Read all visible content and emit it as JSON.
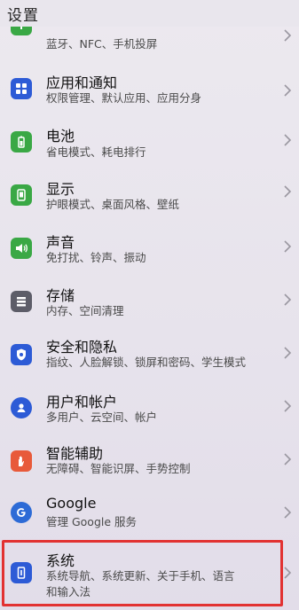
{
  "header": {
    "title": "设置"
  },
  "items": [
    {
      "label": "",
      "sub": "蓝牙、NFC、手机投屏",
      "icon": "link-icon",
      "color": "#3aa845"
    },
    {
      "label": "应用和通知",
      "sub": "权限管理、默认应用、应用分身",
      "icon": "apps-grid-icon",
      "color": "#2d5bd6"
    },
    {
      "label": "电池",
      "sub": "省电模式、耗电排行",
      "icon": "battery-icon",
      "color": "#3aa845"
    },
    {
      "label": "显示",
      "sub": "护眼模式、桌面风格、壁纸",
      "icon": "phone-display-icon",
      "color": "#3aa845"
    },
    {
      "label": "声音",
      "sub": "免打扰、铃声、振动",
      "icon": "speaker-icon",
      "color": "#3aa845"
    },
    {
      "label": "存储",
      "sub": "内存、空间清理",
      "icon": "storage-icon",
      "color": "#5d5d68"
    },
    {
      "label": "安全和隐私",
      "sub": "指纹、人脸解锁、锁屏和密码、学生模式",
      "icon": "shield-icon",
      "color": "#2d5bd6"
    },
    {
      "label": "用户和帐户",
      "sub": "多用户、云空间、帐户",
      "icon": "user-icon",
      "color": "#2d5bd6"
    },
    {
      "label": "智能辅助",
      "sub": "无障碍、智能识屏、手势控制",
      "icon": "hand-icon",
      "color": "#e85a3a"
    },
    {
      "label": "Google",
      "sub": "管理 Google 服务",
      "icon": "google-g-icon",
      "color": "#2d6bd6"
    },
    {
      "label": "系统",
      "sub": "系统导航、系统更新、关于手机、语言",
      "sub2": "和输入法",
      "icon": "phone-info-icon",
      "color": "#2d5bd6"
    }
  ]
}
